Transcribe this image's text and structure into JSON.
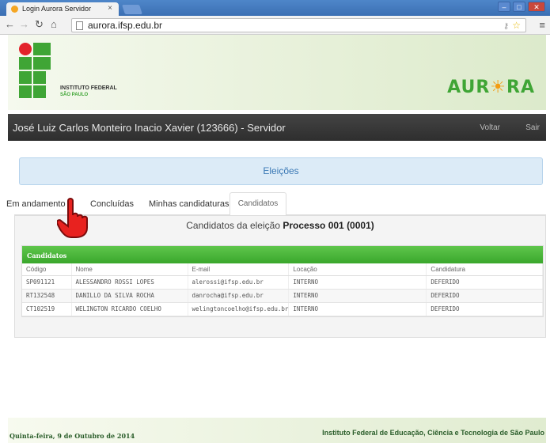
{
  "browser": {
    "tab_title": "Login Aurora Servidor",
    "tab_close": "×",
    "url": "aurora.ifsp.edu.br"
  },
  "header": {
    "institute_name": "INSTITUTO FEDERAL",
    "institute_sub": "SÃO PAULO",
    "logo_text_left": "AUR",
    "logo_text_sun": "☀",
    "logo_text_right": "RA"
  },
  "userbar": {
    "user_name": "José Luiz Carlos Monteiro Inacio Xavier (123666) - Servidor",
    "back_label": "Voltar",
    "exit_label": "Sair"
  },
  "elections_title": "Eleições",
  "tabs": [
    {
      "label": "Em andamento"
    },
    {
      "label": "Concluídas"
    },
    {
      "label": "Minhas candidaturas"
    },
    {
      "label": "Candidatos"
    }
  ],
  "panel": {
    "title_prefix": "Candidatos da eleição",
    "title_bold": "Processo 001 (0001)",
    "table_heading": "Candidatos",
    "columns": [
      "Código",
      "Nome",
      "E-mail",
      "Locação",
      "Candidatura"
    ],
    "rows": [
      [
        "SP091121",
        "ALESSANDRO ROSSI LOPES",
        "alerossi@ifsp.edu.br",
        "INTERNO",
        "DEFERIDO"
      ],
      [
        "RT132548",
        "DANILLO DA SILVA ROCHA",
        "danrocha@ifsp.edu.br",
        "INTERNO",
        "DEFERIDO"
      ],
      [
        "CT102519",
        "WELINGTON RICARDO COELHO",
        "welingtoncoelho@ifsp.edu.br",
        "INTERNO",
        "DEFERIDO"
      ]
    ]
  },
  "footer": {
    "date": "Quinta-feira, 9 de Outubro de 2014",
    "institution": "Instituto Federal de Educação, Ciência e Tecnologia de São Paulo"
  },
  "colors": {
    "ifsp_green": "#3fa535",
    "ifsp_red": "#e3232b",
    "table_head_green": "#3aa72c",
    "info_blue": "#dcebf7"
  }
}
